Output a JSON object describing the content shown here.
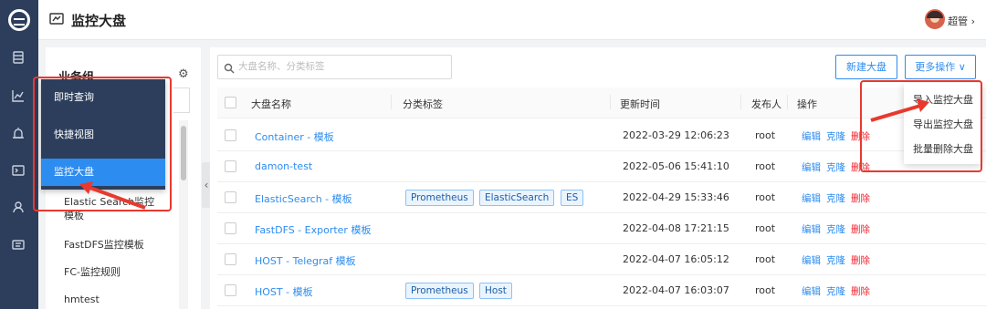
{
  "header": {
    "title": "监控大盘",
    "username": "超管"
  },
  "rail": {
    "icons": [
      "logo-icon",
      "dashboard-icon",
      "chart-icon",
      "alarm-icon",
      "terminal-icon",
      "user-icon",
      "message-icon"
    ]
  },
  "group_panel": {
    "title": "业务组",
    "items": [
      "Elastic Search监控模板",
      "FastDFS监控模板",
      "FC-监控规则",
      "hmtest"
    ]
  },
  "nav_popup": {
    "items": [
      "即时查询",
      "快捷视图",
      "监控大盘"
    ],
    "active": "监控大盘"
  },
  "toolbar": {
    "search_placeholder": "大盘名称、分类标签",
    "new_button": "新建大盘",
    "more_button": "更多操作"
  },
  "table": {
    "columns": [
      "大盘名称",
      "分类标签",
      "更新时间",
      "发布人",
      "操作"
    ],
    "rows": [
      {
        "name": "Container - 模板",
        "tags": [],
        "updated": "2022-03-29 12:06:23",
        "publisher": "root"
      },
      {
        "name": "damon-test",
        "tags": [],
        "updated": "2022-05-06 15:41:10",
        "publisher": "root"
      },
      {
        "name": "ElasticSearch - 模板",
        "tags": [
          "Prometheus",
          "ElasticSearch",
          "ES"
        ],
        "updated": "2022-04-29 15:33:46",
        "publisher": "root"
      },
      {
        "name": "FastDFS - Exporter 模板",
        "tags": [],
        "updated": "2022-04-08 17:21:15",
        "publisher": "root"
      },
      {
        "name": "HOST - Telegraf 模板",
        "tags": [],
        "updated": "2022-04-07 16:05:12",
        "publisher": "root"
      },
      {
        "name": "HOST - 模板",
        "tags": [
          "Prometheus",
          "Host"
        ],
        "updated": "2022-04-07 16:03:07",
        "publisher": "root"
      }
    ],
    "ops": {
      "edit": "编辑",
      "clone": "克隆",
      "delete": "删除"
    }
  },
  "more_menu": {
    "items": [
      "导入监控大盘",
      "导出监控大盘",
      "批量删除大盘"
    ]
  },
  "colors": {
    "accent": "#2d8cf0",
    "danger": "#f5222d",
    "sidebar": "#2c3e5c",
    "annotation": "#e8392f"
  }
}
